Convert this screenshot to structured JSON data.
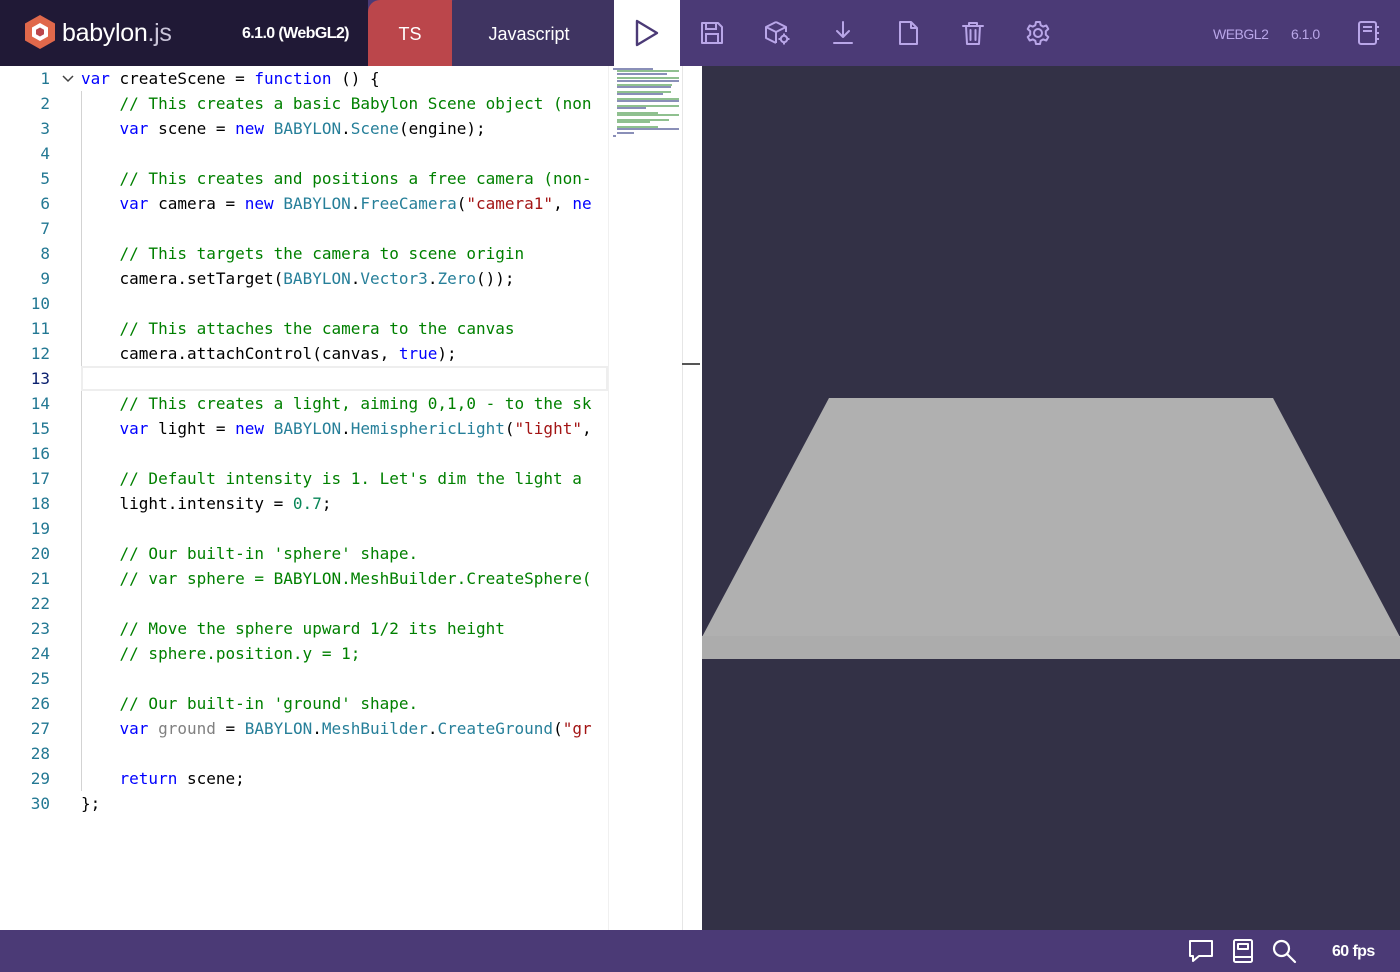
{
  "header": {
    "logo_text_main": "babylon",
    "logo_text_ext": ".js",
    "version_label": "6.1.0 (WebGL2)",
    "tabs": [
      {
        "label": "TS",
        "active": false
      },
      {
        "label": "Javascript",
        "active": true
      }
    ],
    "toolbar": {
      "run_icon": "play-icon",
      "save_icon": "save-icon",
      "inspector_icon": "cube-gear-icon",
      "download_icon": "download-icon",
      "new_icon": "new-file-icon",
      "clear_icon": "trash-icon",
      "settings_icon": "gear-icon"
    },
    "engine_label": "WEBGL2",
    "engine_version": "6.1.0",
    "examples_icon": "examples-icon"
  },
  "editor": {
    "current_line": 13,
    "lines": [
      {
        "n": "1",
        "html": "<span class=\"tok-kw\">var</span> createScene = <span class=\"tok-kw\">function</span> () {"
      },
      {
        "n": "2",
        "html": "    <span class=\"tok-cm\">// This creates a basic Babylon Scene object (non</span>"
      },
      {
        "n": "3",
        "html": "    <span class=\"tok-kw\">var</span> scene = <span class=\"tok-kw\">new</span> <span class=\"tok-typ\">BABYLON</span>.<span class=\"tok-typ\">Scene</span>(engine);"
      },
      {
        "n": "4",
        "html": ""
      },
      {
        "n": "5",
        "html": "    <span class=\"tok-cm\">// This creates and positions a free camera (non-</span>"
      },
      {
        "n": "6",
        "html": "    <span class=\"tok-kw\">var</span> camera = <span class=\"tok-kw\">new</span> <span class=\"tok-typ\">BABYLON</span>.<span class=\"tok-typ\">FreeCamera</span>(<span class=\"tok-str\">\"camera1\"</span>, <span class=\"tok-kw\">ne</span>"
      },
      {
        "n": "7",
        "html": ""
      },
      {
        "n": "8",
        "html": "    <span class=\"tok-cm\">// This targets the camera to scene origin</span>"
      },
      {
        "n": "9",
        "html": "    camera.setTarget(<span class=\"tok-typ\">BABYLON</span>.<span class=\"tok-typ\">Vector3</span>.<span class=\"tok-typ\">Zero</span>());"
      },
      {
        "n": "10",
        "html": ""
      },
      {
        "n": "11",
        "html": "    <span class=\"tok-cm\">// This attaches the camera to the canvas</span>"
      },
      {
        "n": "12",
        "html": "    camera.attachControl(canvas, <span class=\"tok-kw\">true</span>);"
      },
      {
        "n": "13",
        "html": ""
      },
      {
        "n": "14",
        "html": "    <span class=\"tok-cm\">// This creates a light, aiming 0,1,0 - to the sk</span>"
      },
      {
        "n": "15",
        "html": "    <span class=\"tok-kw\">var</span> light = <span class=\"tok-kw\">new</span> <span class=\"tok-typ\">BABYLON</span>.<span class=\"tok-typ\">HemisphericLight</span>(<span class=\"tok-str\">\"light\"</span>,"
      },
      {
        "n": "16",
        "html": ""
      },
      {
        "n": "17",
        "html": "    <span class=\"tok-cm\">// Default intensity is 1. Let's dim the light a</span>"
      },
      {
        "n": "18",
        "html": "    light.intensity = <span class=\"tok-num\">0.7</span>;"
      },
      {
        "n": "19",
        "html": ""
      },
      {
        "n": "20",
        "html": "    <span class=\"tok-cm\">// Our built-in 'sphere' shape.</span>"
      },
      {
        "n": "21",
        "html": "    <span class=\"tok-cm\">// var sphere = BABYLON.MeshBuilder.CreateSphere(</span>"
      },
      {
        "n": "22",
        "html": ""
      },
      {
        "n": "23",
        "html": "    <span class=\"tok-cm\">// Move the sphere upward 1/2 its height</span>"
      },
      {
        "n": "24",
        "html": "    <span class=\"tok-cm\">// sphere.position.y = 1;</span>"
      },
      {
        "n": "25",
        "html": ""
      },
      {
        "n": "26",
        "html": "    <span class=\"tok-cm\">// Our built-in 'ground' shape.</span>"
      },
      {
        "n": "27",
        "html": "    <span class=\"tok-kw\">var</span> <span class=\"tok-dim\">ground</span> = <span class=\"tok-typ\">BABYLON</span>.<span class=\"tok-typ\">MeshBuilder</span>.<span class=\"tok-typ\">CreateGround</span>(<span class=\"tok-str\">\"gr</span>"
      },
      {
        "n": "28",
        "html": ""
      },
      {
        "n": "29",
        "html": "    <span class=\"tok-kw\">return</span> scene;"
      },
      {
        "n": "30",
        "html": "};"
      }
    ]
  },
  "footer": {
    "feedback_icon": "speech-bubble-icon",
    "docs_icon": "book-icon",
    "search_icon": "search-icon",
    "fps": "60 fps"
  },
  "colors": {
    "header_bg": "#4b3a76",
    "logo_bg": "#201936",
    "ts_tab": "#bb464b",
    "js_tab": "#3f3461",
    "canvas_bg": "#333146",
    "ground": "#b0b0b0"
  }
}
